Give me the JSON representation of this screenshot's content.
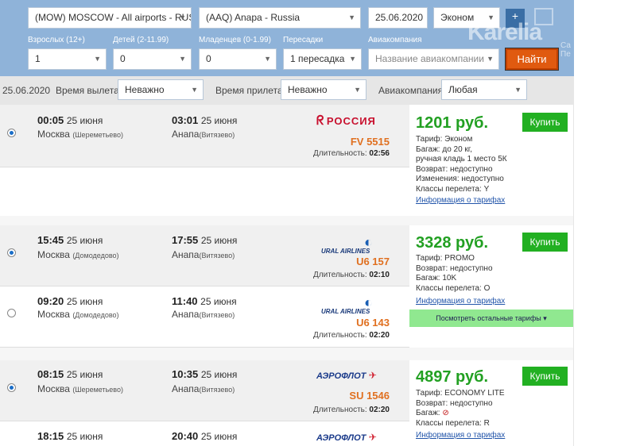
{
  "search": {
    "origin": "(MOW) MOSCOW - All airports - RUS",
    "destination": "(AAQ) Anapa - Russia",
    "date": "25.06.2020",
    "class": "Эконом",
    "labels": {
      "adults": "Взрослых (12+)",
      "children": "Детей (2-11.99)",
      "infants": "Младенцев (0-1.99)",
      "transfers": "Пересадки",
      "airline": "Авиакомпания"
    },
    "adults": "1",
    "children": "0",
    "infants": "0",
    "transfers": "1 пересадка",
    "airline_placeholder": "Название авиакомпании",
    "find_label": "Найти",
    "plus_label": "+"
  },
  "watermark": {
    "text": "Karelia",
    "small": "Са Пе"
  },
  "filter": {
    "date": "25.06.2020",
    "dep_label": "Время вылета",
    "dep_value": "Неважно",
    "arr_label": "Время прилета",
    "arr_value": "Неважно",
    "airline_label": "Авиакомпания",
    "airline_value": "Любая"
  },
  "common": {
    "duration_label": "Длительность:",
    "buy_label": "Купить",
    "tariff_link": "Информация о тарифах",
    "more_tariffs": "Посмотреть остальные тарифы"
  },
  "flights": [
    {
      "dep_time": "00:05",
      "dep_date": "25 июня",
      "dep_city": "Москва",
      "dep_airport": "(Шереметьево)",
      "arr_time": "03:01",
      "arr_date": "25 июня",
      "arr_city": "Анапа",
      "arr_airport": "(Витязево)",
      "airline_logo": "РОССИЯ",
      "flight_no": "FV 5515",
      "duration": "02:56",
      "selected": true
    },
    {
      "dep_time": "15:45",
      "dep_date": "25 июня",
      "dep_city": "Москва",
      "dep_airport": "(Домодедово)",
      "arr_time": "17:55",
      "arr_date": "25 июня",
      "arr_city": "Анапа",
      "arr_airport": "(Витязево)",
      "airline_logo": "URAL AIRLINES",
      "flight_no": "U6 157",
      "duration": "02:10",
      "selected": true
    },
    {
      "dep_time": "09:20",
      "dep_date": "25 июня",
      "dep_city": "Москва",
      "dep_airport": "(Домодедово)",
      "arr_time": "11:40",
      "arr_date": "25 июня",
      "arr_city": "Анапа",
      "arr_airport": "(Витязево)",
      "airline_logo": "URAL AIRLINES",
      "flight_no": "U6 143",
      "duration": "02:20",
      "selected": false
    },
    {
      "dep_time": "08:15",
      "dep_date": "25 июня",
      "dep_city": "Москва",
      "dep_airport": "(Шереметьево)",
      "arr_time": "10:35",
      "arr_date": "25 июня",
      "arr_city": "Анапа",
      "arr_airport": "(Витязево)",
      "airline_logo": "АЭРОФЛОТ",
      "flight_no": "SU 1546",
      "duration": "02:20",
      "selected": true
    },
    {
      "dep_time": "18:15",
      "dep_date": "25 июня",
      "arr_time": "20:40",
      "arr_date": "25 июня",
      "airline_logo": "АЭРОФЛОТ",
      "selected": false
    }
  ],
  "offers": [
    {
      "price": "1201 руб.",
      "lines": [
        "Тариф: Эконом",
        "Багаж: до 20 кг,",
        "ручная кладь 1 место 5К",
        "Возврат: недоступно",
        "Изменения: недоступно",
        "Классы перелета: Y"
      ]
    },
    {
      "price": "3328 руб.",
      "lines": [
        "Тариф: PROMO",
        "Возврат: недоступно",
        "Багаж: 10K",
        "Классы перелета: O"
      ]
    },
    {
      "price": "4897 руб.",
      "lines": [
        "Тариф: ECONOMY LITE",
        "Возврат: недоступно",
        "Багаж:",
        "Классы перелета: R"
      ]
    }
  ],
  "colors": {
    "search_bg": "#8fb3d9",
    "price_green": "#22a022",
    "flight_orange": "#e07020",
    "find_orange": "#e05a10"
  }
}
